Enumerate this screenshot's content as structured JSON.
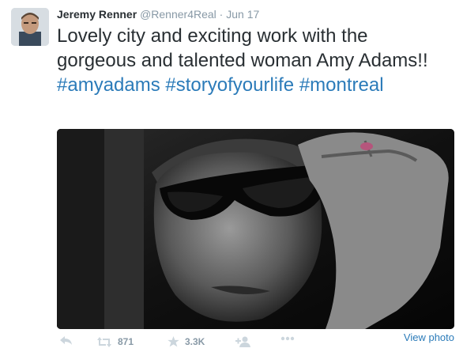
{
  "tweet": {
    "author_name": "Jeremy Renner",
    "handle": "@Renner4Real",
    "separator": "·",
    "date": "Jun 17",
    "text_plain": "Lovely city and exciting work with the gorgeous and talented woman Amy Adams!!",
    "hashtags": [
      "#amyadams",
      "#storyofyourlife",
      "#montreal"
    ]
  },
  "media": {
    "view_photo_label": "View photo"
  },
  "actions": {
    "reply_icon": "reply-icon",
    "retweet_icon": "retweet-icon",
    "retweet_count": "871",
    "favorite_icon": "star-icon",
    "favorite_count": "3.3K",
    "follow_icon": "follow-icon",
    "more_icon": "more-icon"
  },
  "colors": {
    "link": "#2b7bb9",
    "muted": "#8899a6",
    "icon": "#ccd6dd",
    "text": "#292f33"
  }
}
